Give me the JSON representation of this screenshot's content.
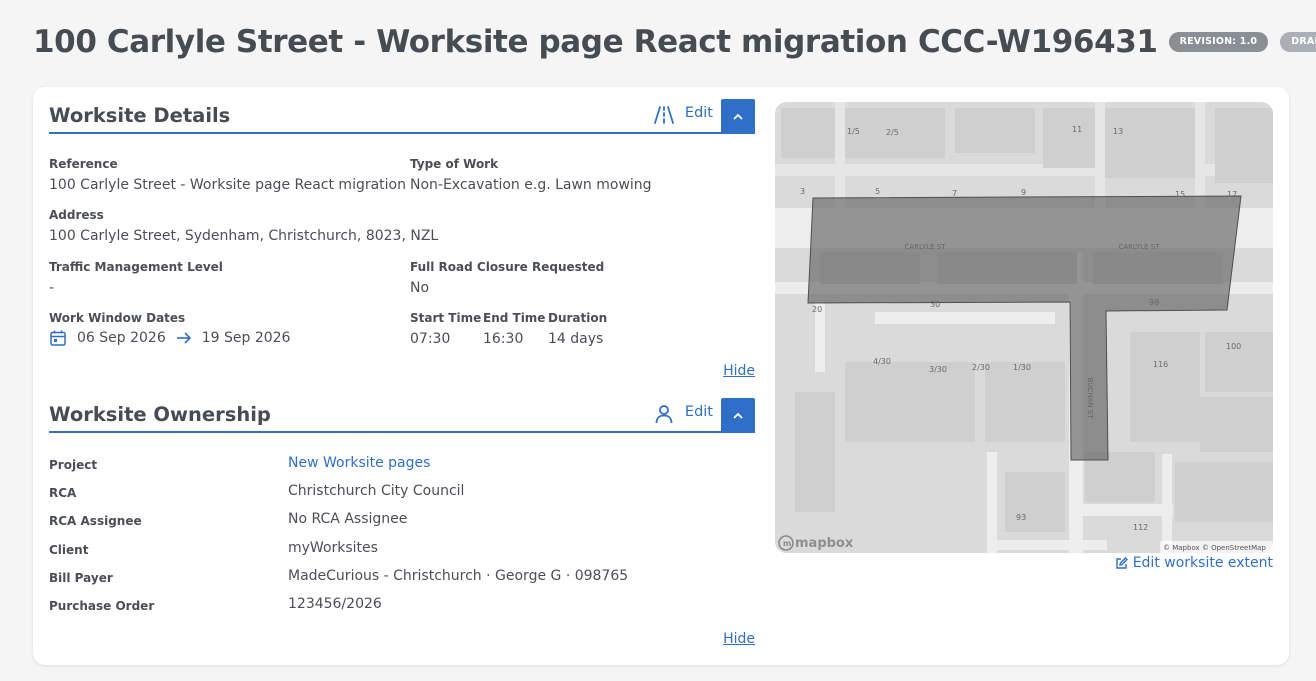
{
  "header": {
    "title": "100 Carlyle Street - Worksite page React migration CCC-W196431",
    "revision_badge": "REVISION: 1.0",
    "status_badge": "DRAFT"
  },
  "details": {
    "title": "Worksite Details",
    "icon": "road-icon",
    "edit_label": "Edit",
    "reference_label": "Reference",
    "reference_value": "100 Carlyle Street - Worksite page React migration",
    "type_label": "Type of Work",
    "type_value": "Non-Excavation e.g. Lawn mowing",
    "address_label": "Address",
    "address_value": "100 Carlyle Street, Sydenham, Christchurch, 8023, NZL",
    "tm_label": "Traffic Management Level",
    "tm_value": "-",
    "closure_label": "Full Road Closure Requested",
    "closure_value": "No",
    "window_label": "Work Window Dates",
    "start_date": "06 Sep 2026",
    "end_date": "19 Sep 2026",
    "start_time_label": "Start Time",
    "start_time_value": "07:30",
    "end_time_label": "End Time",
    "end_time_value": "16:30",
    "duration_label": "Duration",
    "duration_value": "14 days",
    "hide_label": "Hide"
  },
  "ownership": {
    "title": "Worksite Ownership",
    "icon": "user-icon",
    "edit_label": "Edit",
    "rows": [
      {
        "label": "Project",
        "value": "New Worksite pages"
      },
      {
        "label": "RCA",
        "value": "Christchurch City Council"
      },
      {
        "label": "RCA Assignee",
        "value": "No RCA Assignee"
      },
      {
        "label": "Client",
        "value": "myWorksites"
      },
      {
        "label": "Bill Payer",
        "value": "MadeCurious - Christchurch · George G · 098765"
      },
      {
        "label": "Purchase Order",
        "value": "123456/2026"
      }
    ],
    "hide_label": "Hide"
  },
  "map": {
    "street_labels": [
      "CARLYLE ST",
      "CARLYLE ST",
      "BUCHAN ST"
    ],
    "numbers": [
      "1/5",
      "2/5",
      "11",
      "13",
      "3",
      "5",
      "7",
      "9",
      "15",
      "17",
      "20",
      "30",
      "98",
      "4/30",
      "3/30",
      "2/30",
      "1/30",
      "116",
      "100",
      "93",
      "112"
    ],
    "logo": "mapbox",
    "attribution": "© Mapbox © OpenStreetMap",
    "edit_extent_label": "Edit worksite extent"
  },
  "colors": {
    "accent": "#2f6fc7",
    "badge_revision": "#8a8f95",
    "badge_draft": "#aab0b6"
  }
}
